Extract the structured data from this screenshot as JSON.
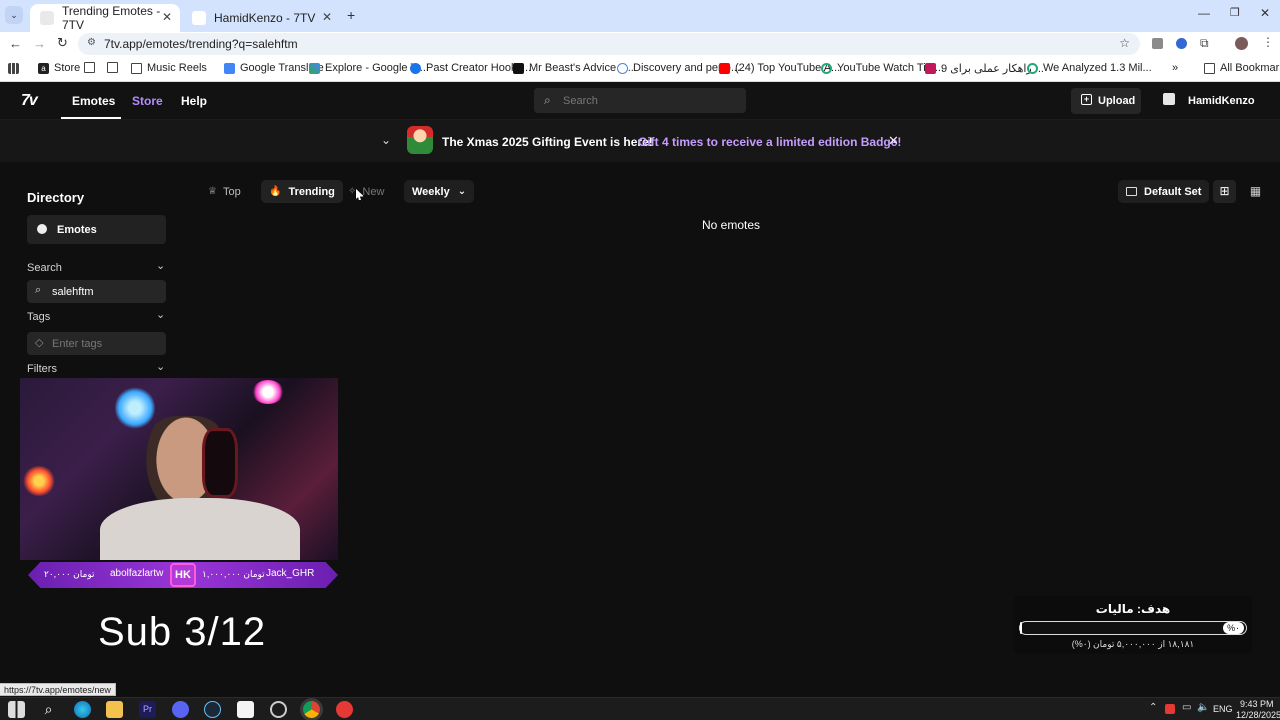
{
  "browser": {
    "tabs": [
      {
        "title": "Trending Emotes - 7TV",
        "active": true
      },
      {
        "title": "HamidKenzo - 7TV",
        "active": false
      }
    ],
    "url": "7tv.app/emotes/trending?q=salehftm",
    "bookmarks": [
      "Store",
      "",
      "",
      "Music Reels",
      "Google Translate",
      "Explore - Google Tr...",
      "Past Creator Hooks...",
      "Mr Beast's Advice F...",
      "Discovery and perfo...",
      "(24) Top YouTube A...",
      "YouTube Watch Tim...",
      "9 راهکار عملی برای ...",
      "We Analyzed 1.3 Mil..."
    ],
    "all_bookmarks": "All Bookmarks"
  },
  "nav": {
    "logo": "7v",
    "links": [
      "Emotes",
      "Store",
      "Help"
    ],
    "search_placeholder": "Search",
    "upload": "Upload",
    "username": "HamidKenzo"
  },
  "banner": {
    "text": "The Xmas 2025 Gifting Event is here!",
    "link": "Gift 4 times to receive a limited edition Badge!"
  },
  "sidebar": {
    "title": "Directory",
    "emotes_label": "Emotes",
    "search_label": "Search",
    "search_value": "salehftm",
    "tags_label": "Tags",
    "tags_placeholder": "Enter tags",
    "filters_label": "Filters"
  },
  "toolbar": {
    "top": "Top",
    "trending": "Trending",
    "new": "New",
    "period": "Weekly",
    "default_set": "Default Set"
  },
  "main": {
    "empty_text": "No emotes"
  },
  "overlay": {
    "donor_left": "abolfazlartw",
    "donor_left_amount": "۲۰,۰۰۰ تومان",
    "donor_badge": "HK",
    "donor_right_amount": "۱,۰۰۰,۰۰۰ تومان",
    "donor_right": "Jack_GHR",
    "sub_text": "Sub 3/12",
    "goal_title": "هدف: ماليات",
    "goal_percent_label": "%۰",
    "goal_progress": 0.01,
    "goal_detail": "۱۸,۱۸۱ از ۵,۰۰۰,۰۰۰ تومان (۰%)"
  },
  "status_url": "https://7tv.app/emotes/new",
  "taskbar": {
    "lang": "ENG",
    "time": "9:43 PM",
    "date": "12/28/2025"
  },
  "colors": {
    "accent_purple": "#b48cff",
    "banner_link": "#c69cff",
    "nav_bg": "#121212",
    "page_bg": "#0f0f0f"
  }
}
